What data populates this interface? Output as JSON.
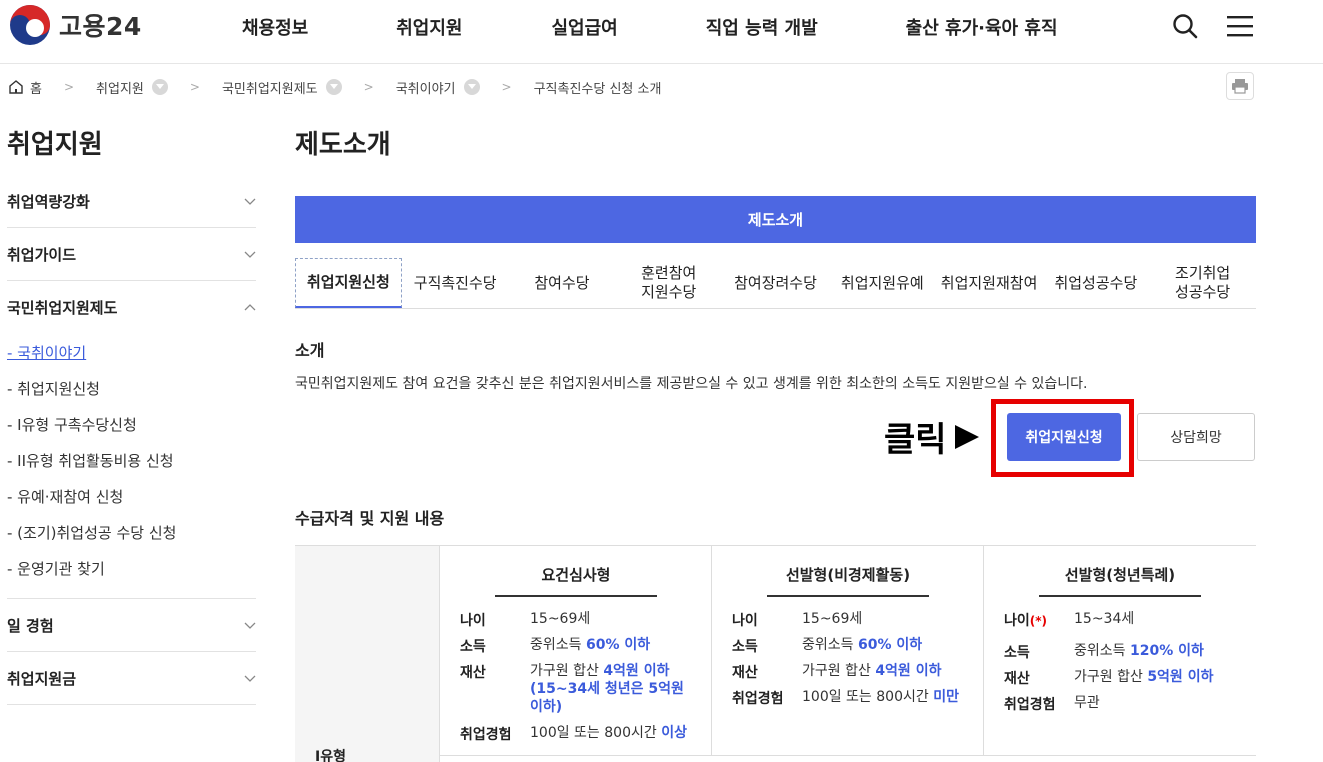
{
  "header": {
    "logo_text": "고용24",
    "nav": [
      "채용정보",
      "취업지원",
      "실업급여",
      "직업 능력 개발",
      "출산 휴가·육아 휴직"
    ]
  },
  "breadcrumb": {
    "home": "홈",
    "items": [
      "취업지원",
      "국민취업지원제도",
      "국취이야기",
      "구직촉진수당 신청 소개"
    ]
  },
  "sidebar": {
    "title": "취업지원",
    "groups": [
      "취업역량강화",
      "취업가이드",
      "국민취업지원제도",
      "일 경험",
      "취업지원금"
    ],
    "sub_items": [
      "- 국취이야기",
      "- 취업지원신청",
      "- I유형 구촉수당신청",
      "- II유형 취업활동비용 신청",
      "- 유예·재참여 신청",
      "- (조기)취업성공 수당 신청",
      "- 운영기관 찾기"
    ]
  },
  "main": {
    "title": "제도소개",
    "bar_label": "제도소개",
    "tabs": [
      "취업지원신청",
      "구직촉진수당",
      "참여수당",
      "훈련참여\n지원수당",
      "참여장려수당",
      "취업지원유예",
      "취업지원재참여",
      "취업성공수당",
      "조기취업\n성공수당"
    ],
    "intro_heading": "소개",
    "intro_text": "국민취업지원제도 참여 요건을 갖추신 분은 취업지원서비스를 제공받으실 수 있고 생계를 위한 최소한의 소득도 지원받으실 수 있습니다.",
    "click_label": "클릭",
    "apply_button": "취업지원신청",
    "consult_button": "상담희망",
    "eligibility_heading": "수급자격 및 지원 내용",
    "type_label": "I유형",
    "columns": [
      {
        "head": "요건심사형",
        "rows": [
          {
            "k": "나이",
            "v": "15~69세",
            "hl": ""
          },
          {
            "k": "소득",
            "v": "중위소득 ",
            "hl": "60% 이하"
          },
          {
            "k": "재산",
            "v": "가구원 합산 ",
            "hl": "4억원 이하",
            "extra": "(15~34세 청년은 5억원 이하)"
          },
          {
            "k": "취업경험",
            "v": "100일 또는 800시간 ",
            "hl": "이상"
          }
        ]
      },
      {
        "head": "선발형(비경제활동)",
        "rows": [
          {
            "k": "나이",
            "v": "15~69세",
            "hl": ""
          },
          {
            "k": "소득",
            "v": "중위소득 ",
            "hl": "60% 이하"
          },
          {
            "k": "재산",
            "v": "가구원 합산 ",
            "hl": "4억원 이하"
          },
          {
            "k": "취업경험",
            "v": "100일 또는 800시간 ",
            "hl": "미만"
          }
        ]
      },
      {
        "head": "선발형(청년특례)",
        "rows": [
          {
            "k": "나이",
            "req": "(*)",
            "v": "15~34세",
            "hl": ""
          },
          {
            "k": "소득",
            "v": "중위소득 ",
            "hl": "120% 이하"
          },
          {
            "k": "재산",
            "v": "가구원 합산 ",
            "hl": "5억원 이하"
          },
          {
            "k": "취업경험",
            "v": "무관",
            "hl": ""
          }
        ]
      }
    ]
  },
  "colors": {
    "brand_blue": "#4d67e2",
    "highlight_red": "#e60000",
    "link_blue": "#3b5bdb"
  }
}
